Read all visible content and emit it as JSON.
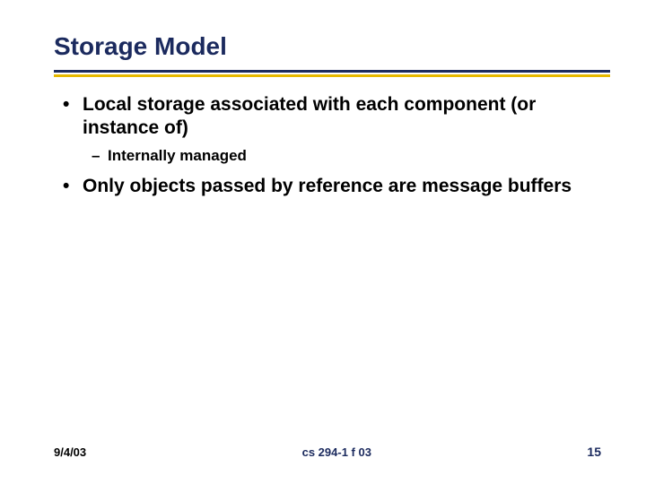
{
  "title": "Storage Model",
  "bullets": {
    "b1a": "Local storage associated with each component (or instance of)",
    "b2a": "Internally managed",
    "b1b": "Only objects passed by reference are message buffers"
  },
  "footer": {
    "date": "9/4/03",
    "course": "cs 294-1 f 03",
    "page": "15"
  }
}
